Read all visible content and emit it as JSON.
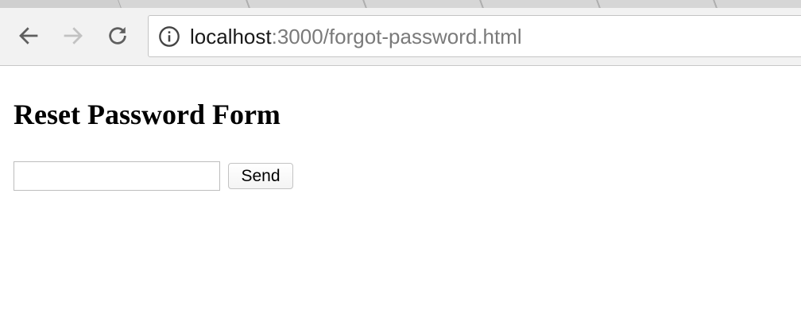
{
  "browser": {
    "tab_count": 6,
    "nav": {
      "back_icon": "arrow-left-icon",
      "forward_icon": "arrow-right-icon",
      "reload_icon": "reload-icon"
    },
    "address_bar": {
      "icon": "info-icon",
      "host": "localhost",
      "path": ":3000/forgot-password.html"
    }
  },
  "page": {
    "title": "Reset Password Form",
    "form": {
      "email_value": "",
      "email_placeholder": "",
      "send_label": "Send"
    }
  },
  "colors": {
    "toolbar_bg": "#f2f2f2",
    "tab_strip_bg": "#cfcfcf",
    "url_host": "#1a1a1a",
    "url_path": "#7a7a7a"
  }
}
